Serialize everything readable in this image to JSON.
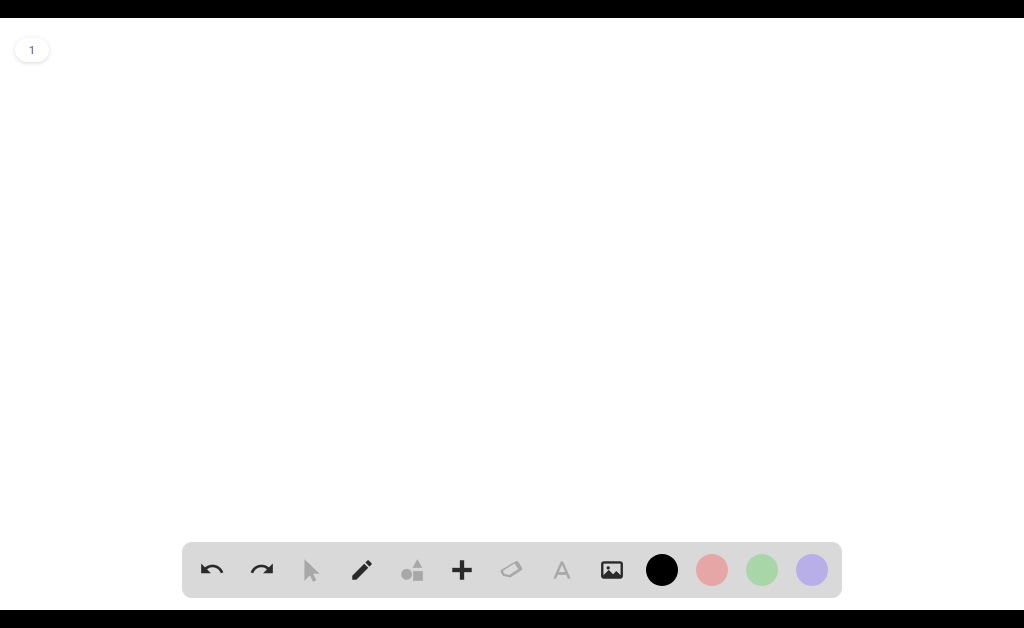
{
  "page": {
    "number": "1"
  },
  "toolbar": {
    "items": [
      {
        "name": "undo-button",
        "icon": "undo-icon",
        "active": true
      },
      {
        "name": "redo-button",
        "icon": "redo-icon",
        "active": true
      },
      {
        "name": "pointer-tool",
        "icon": "pointer-icon",
        "active": false
      },
      {
        "name": "pencil-tool",
        "icon": "pencil-icon",
        "active": true
      },
      {
        "name": "shapes-tool",
        "icon": "shapes-icon",
        "active": false
      },
      {
        "name": "plus-tool",
        "icon": "plus-icon",
        "active": true
      },
      {
        "name": "eraser-tool",
        "icon": "eraser-icon",
        "active": false
      },
      {
        "name": "text-tool",
        "icon": "text-icon",
        "active": false
      },
      {
        "name": "image-tool",
        "icon": "image-icon",
        "active": true
      }
    ]
  },
  "colors": {
    "swatches": [
      {
        "name": "color-black",
        "hex": "#000000"
      },
      {
        "name": "color-red",
        "hex": "#e6a6a6"
      },
      {
        "name": "color-green",
        "hex": "#a8d6a8"
      },
      {
        "name": "color-purple",
        "hex": "#b9afe8"
      }
    ]
  }
}
